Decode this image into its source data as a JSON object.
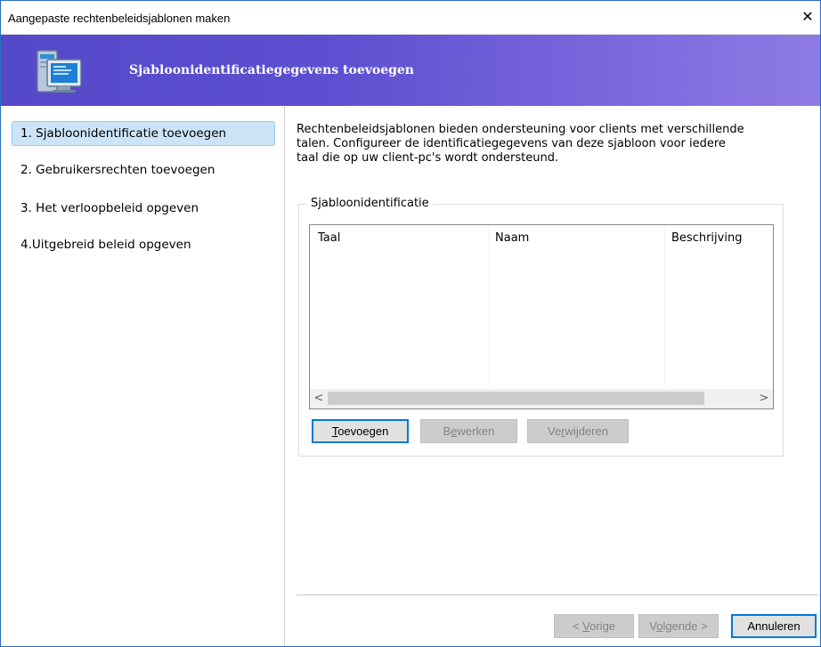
{
  "window": {
    "title": "Aangepaste rechtenbeleidsjablonen maken",
    "close_glyph": "✕"
  },
  "header": {
    "title": "Sjabloonidentificatiegegevens toevoegen",
    "icon": "computer-monitor-icon",
    "gradient_from": "#5548c9",
    "gradient_to": "#8f7be3"
  },
  "steps": [
    {
      "label": "1. Sjabloonidentificatie toevoegen",
      "active": true
    },
    {
      "label": "2. Gebruikersrechten toevoegen",
      "active": false
    },
    {
      "label": "3. Het verloopbeleid opgeven",
      "active": false
    },
    {
      "label": "4.Uitgebreid beleid opgeven",
      "active": false
    }
  ],
  "description": {
    "line1": "Rechtenbeleidsjablonen bieden ondersteuning voor clients met verschillende",
    "line2": "talen. Configureer de identificatiegegevens van deze sjabloon voor iedere",
    "line3": "taal die op uw client-pc's wordt ondersteund."
  },
  "group": {
    "legend": "Sjabloonidentificatie",
    "columns": [
      "Taal",
      "Naam",
      "Beschrijving"
    ],
    "rows": [],
    "scroll_left": "<",
    "scroll_right": ">"
  },
  "buttons": {
    "add": {
      "mnemonic": "T",
      "rest": "oevoegen",
      "enabled": true
    },
    "edit": {
      "pre": "B",
      "mnemonic": "e",
      "rest": "werken",
      "enabled": false
    },
    "delete": {
      "pre": "Ve",
      "mnemonic": "r",
      "rest": "wijderen",
      "enabled": false
    }
  },
  "footer": {
    "prev": {
      "pre": "< ",
      "mnemonic": "V",
      "rest": "orige",
      "enabled": false
    },
    "next": {
      "pre": "V",
      "mnemonic": "o",
      "rest": "lgende >",
      "enabled": false
    },
    "cancel": {
      "label": "Annuleren",
      "enabled": true
    }
  },
  "colors": {
    "active_step_bg": "#cce4f7",
    "default_button_border": "#0078d7"
  }
}
